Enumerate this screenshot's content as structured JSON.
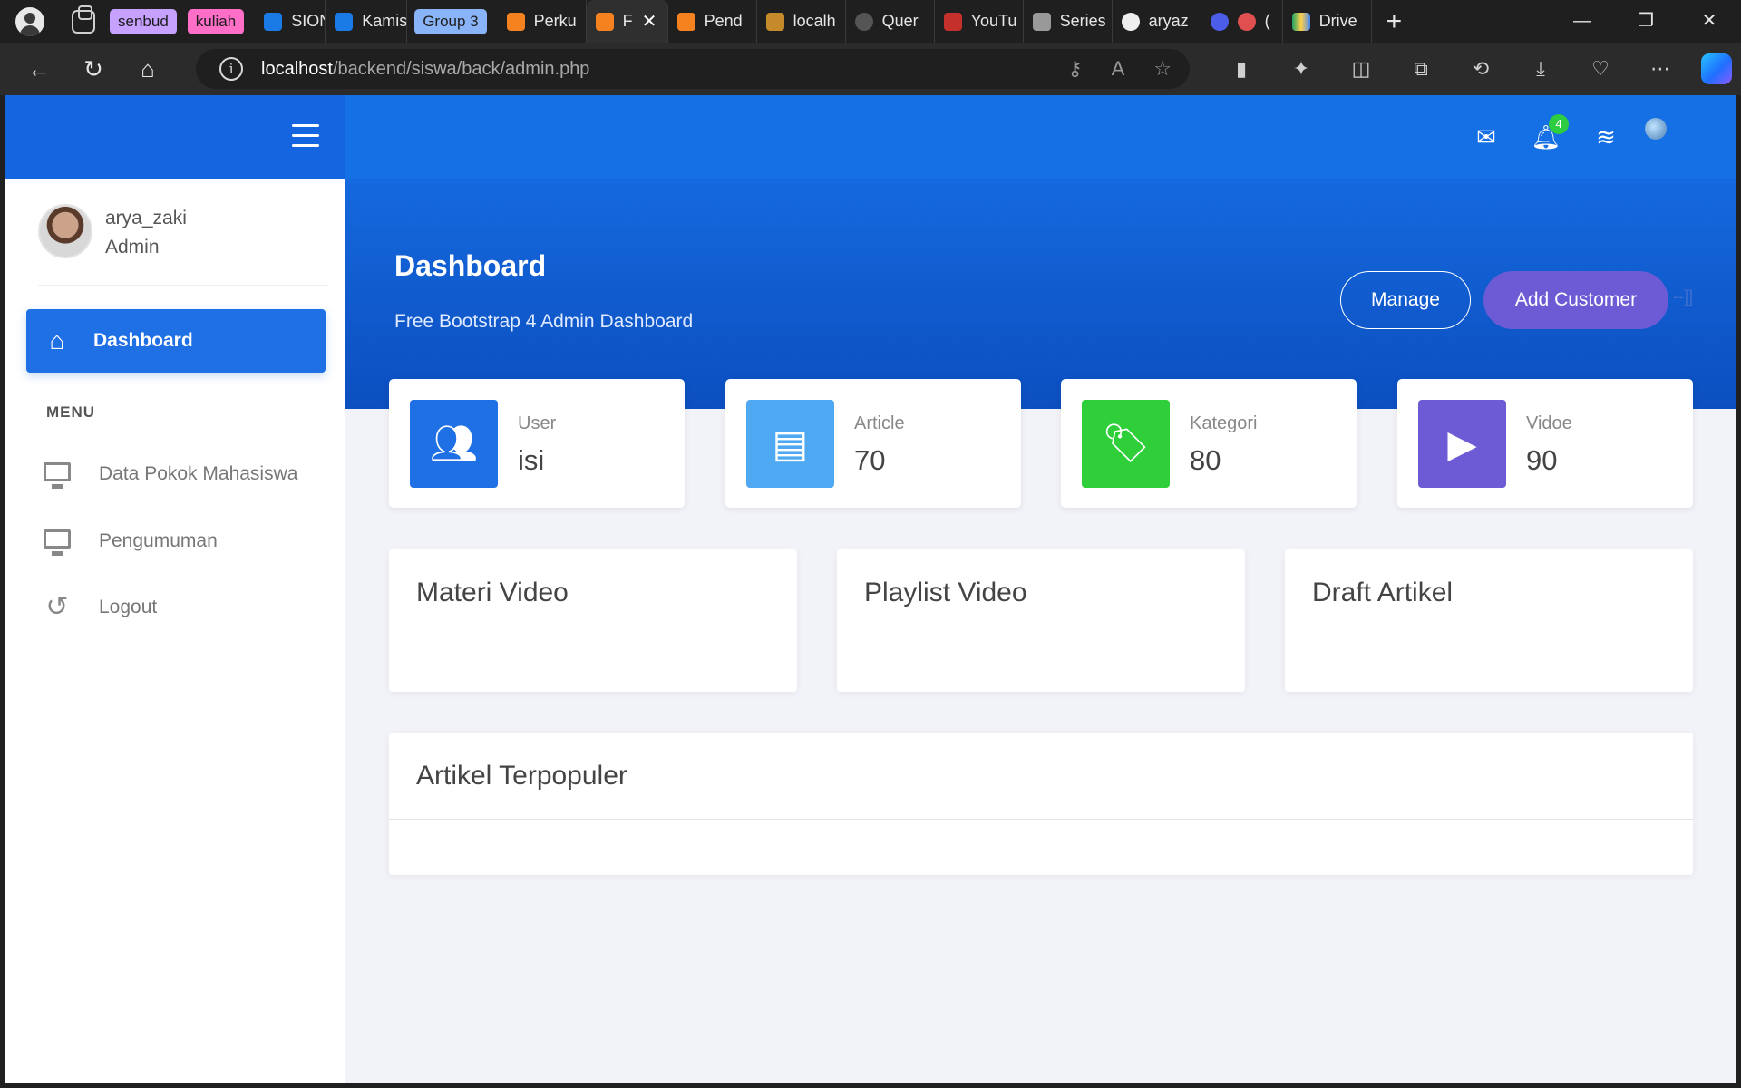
{
  "browser": {
    "tab_groups": [
      {
        "label": "senbud",
        "color": "#c6a1ff"
      },
      {
        "label": "kuliah",
        "color": "#ff6fc8"
      },
      {
        "label": "Group 3",
        "color": "#8ab4f8"
      }
    ],
    "tabs": [
      "SION",
      "Kamis",
      "Perku",
      "F",
      "Pend",
      "localh",
      "Quer",
      "YouTu",
      "Series",
      "aryaz",
      "(",
      "Drive"
    ],
    "url_host": "localhost",
    "url_path": "/backend/siswa/back/admin.php",
    "window_controls": [
      "—",
      "❐",
      "✕"
    ]
  },
  "sidebar": {
    "user_name": "arya_zaki",
    "user_role": "Admin",
    "active_item": "Dashboard",
    "menu_heading": "MENU",
    "items": [
      "Data Pokok Mahasiswa",
      "Pengumuman",
      "Logout"
    ]
  },
  "topbar": {
    "icons": [
      "envelope-icon",
      "bell-icon",
      "layers-icon",
      "avatar"
    ],
    "notification_count": "4"
  },
  "hero": {
    "title": "Dashboard",
    "subtitle": "Free Bootstrap 4 Admin Dashboard",
    "manage_label": "Manage",
    "add_label": "Add Customer",
    "trail": "--]]"
  },
  "stats": [
    {
      "label": "User",
      "value": "isi",
      "color": "#1f6fe5",
      "icon": "users-icon"
    },
    {
      "label": "Article",
      "value": "70",
      "color": "#4ea9f2",
      "icon": "newspaper-icon"
    },
    {
      "label": "Kategori",
      "value": "80",
      "color": "#2fcf3a",
      "icon": "tags-icon"
    },
    {
      "label": "Vidoe",
      "value": "90",
      "color": "#6c5bd4",
      "icon": "video-file-icon"
    }
  ],
  "panels": [
    "Materi Video",
    "Playlist Video",
    "Draft Artikel",
    "Artikel Terpopuler"
  ]
}
